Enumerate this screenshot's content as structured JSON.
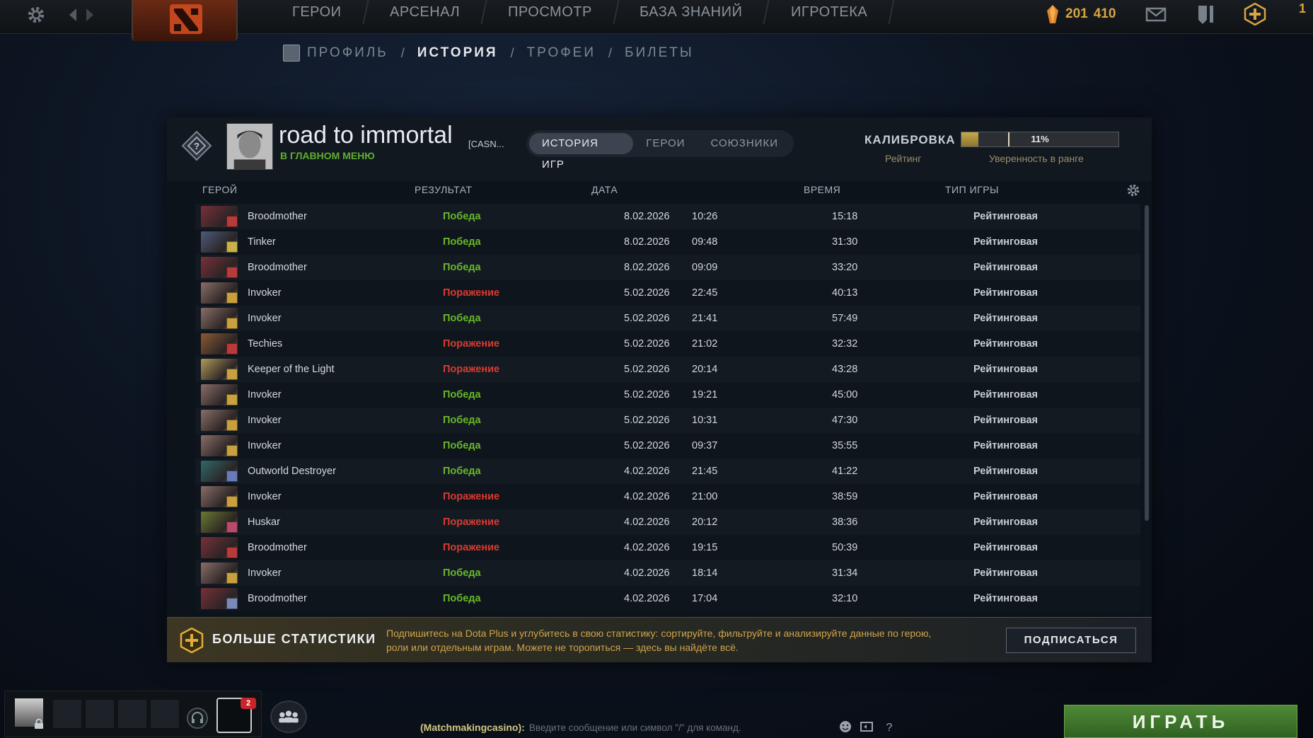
{
  "topnav": {
    "items": [
      "ГЕРОИ",
      "АРСЕНАЛ",
      "ПРОСМОТР",
      "БАЗА ЗНАНИЙ",
      "ИГРОТЕКА"
    ]
  },
  "currency": {
    "shards": "201",
    "coins": "410",
    "edge": "1"
  },
  "subnav": {
    "items": [
      "ПРОФИЛЬ",
      "ИСТОРИЯ",
      "ТРОФЕИ",
      "БИЛЕТЫ"
    ],
    "sep": "/",
    "active": "ИСТОРИЯ"
  },
  "profile": {
    "name": "road to immortal",
    "tag": "[CASN...",
    "status": "В ГЛАВНОМ МЕНЮ"
  },
  "head_tabs": {
    "items": [
      "ИСТОРИЯ ИГР",
      "ГЕРОИ",
      "СОЮЗНИКИ"
    ],
    "active": "ИСТОРИЯ ИГР"
  },
  "calibration": {
    "label": "КАЛИБРОВКА",
    "rating_label": "Рейтинг",
    "confidence_text": "11%",
    "confidence_fraction": 0.11,
    "confidence_label": "Уверенность в ранге"
  },
  "columns": {
    "hero": "ГЕРОЙ",
    "result": "РЕЗУЛЬТАТ",
    "date": "ДАТА",
    "time": "ВРЕМЯ",
    "mode": "ТИП ИГРЫ"
  },
  "matches": [
    {
      "hero": "Broodmother",
      "result": "Победа",
      "win": true,
      "date": "8.02.2026",
      "clock": "10:26",
      "duration": "15:18",
      "mode": "Рейтинговая",
      "color": "#7a2f3a",
      "role": "#b83a3a"
    },
    {
      "hero": "Tinker",
      "result": "Победа",
      "win": true,
      "date": "8.02.2026",
      "clock": "09:48",
      "duration": "31:30",
      "mode": "Рейтинговая",
      "color": "#4d5a7a",
      "role": "#c9b04a"
    },
    {
      "hero": "Broodmother",
      "result": "Победа",
      "win": true,
      "date": "8.02.2026",
      "clock": "09:09",
      "duration": "33:20",
      "mode": "Рейтинговая",
      "color": "#7a2f3a",
      "role": "#b83a3a"
    },
    {
      "hero": "Invoker",
      "result": "Поражение",
      "win": false,
      "date": "5.02.2026",
      "clock": "22:45",
      "duration": "40:13",
      "mode": "Рейтинговая",
      "color": "#8a6e68",
      "role": "#c9a040"
    },
    {
      "hero": "Invoker",
      "result": "Победа",
      "win": true,
      "date": "5.02.2026",
      "clock": "21:41",
      "duration": "57:49",
      "mode": "Рейтинговая",
      "color": "#8a6e68",
      "role": "#c9a040"
    },
    {
      "hero": "Techies",
      "result": "Поражение",
      "win": false,
      "date": "5.02.2026",
      "clock": "21:02",
      "duration": "32:32",
      "mode": "Рейтинговая",
      "color": "#8a5a34",
      "role": "#b83a3a"
    },
    {
      "hero": "Keeper of the Light",
      "result": "Поражение",
      "win": false,
      "date": "5.02.2026",
      "clock": "20:14",
      "duration": "43:28",
      "mode": "Рейтинговая",
      "color": "#b09a5a",
      "role": "#c9a040"
    },
    {
      "hero": "Invoker",
      "result": "Победа",
      "win": true,
      "date": "5.02.2026",
      "clock": "19:21",
      "duration": "45:00",
      "mode": "Рейтинговая",
      "color": "#8a6e68",
      "role": "#c9a040"
    },
    {
      "hero": "Invoker",
      "result": "Победа",
      "win": true,
      "date": "5.02.2026",
      "clock": "10:31",
      "duration": "47:30",
      "mode": "Рейтинговая",
      "color": "#8a6e68",
      "role": "#c9a040"
    },
    {
      "hero": "Invoker",
      "result": "Победа",
      "win": true,
      "date": "5.02.2026",
      "clock": "09:37",
      "duration": "35:55",
      "mode": "Рейтинговая",
      "color": "#8a6e68",
      "role": "#c9a040"
    },
    {
      "hero": "Outworld Destroyer",
      "result": "Победа",
      "win": true,
      "date": "4.02.2026",
      "clock": "21:45",
      "duration": "41:22",
      "mode": "Рейтинговая",
      "color": "#2f6a6a",
      "role": "#6a7ab8"
    },
    {
      "hero": "Invoker",
      "result": "Поражение",
      "win": false,
      "date": "4.02.2026",
      "clock": "21:00",
      "duration": "38:59",
      "mode": "Рейтинговая",
      "color": "#8a6e68",
      "role": "#c9a040"
    },
    {
      "hero": "Huskar",
      "result": "Поражение",
      "win": false,
      "date": "4.02.2026",
      "clock": "20:12",
      "duration": "38:36",
      "mode": "Рейтинговая",
      "color": "#6a7a30",
      "role": "#b84a6a"
    },
    {
      "hero": "Broodmother",
      "result": "Поражение",
      "win": false,
      "date": "4.02.2026",
      "clock": "19:15",
      "duration": "50:39",
      "mode": "Рейтинговая",
      "color": "#7a2f3a",
      "role": "#b83a3a"
    },
    {
      "hero": "Invoker",
      "result": "Победа",
      "win": true,
      "date": "4.02.2026",
      "clock": "18:14",
      "duration": "31:34",
      "mode": "Рейтинговая",
      "color": "#8a6e68",
      "role": "#c9a040"
    },
    {
      "hero": "Broodmother",
      "result": "Победа",
      "win": true,
      "date": "4.02.2026",
      "clock": "17:04",
      "duration": "32:10",
      "mode": "Рейтинговая",
      "color": "#7a2f3a",
      "role": "#7a8ab8"
    }
  ],
  "plus": {
    "title": "БОЛЬШЕ СТАТИСТИКИ",
    "text": "Подпишитесь на Dota Plus и углубитесь в свою статистику: сортируйте, фильтруйте и анализируйте данные по герою, роли или отдельным играм. Можете не торопиться — здесь вы найдёте всё.",
    "button": "ПОДПИСАТЬСЯ"
  },
  "bottom": {
    "inventory_badge": "2",
    "chat_channel": "(Matchmakingcasino):",
    "chat_placeholder": "Введите сообщение или символ \"/\" для команд.",
    "play": "ИГРАТЬ"
  },
  "colors": {
    "win": "#68b82a",
    "loss": "#d93b31",
    "gold": "#d7a642",
    "play": "#3f7a2c"
  },
  "icons": [
    "settings-gear-icon",
    "back-arrow-icon",
    "forward-arrow-icon",
    "dota-logo-icon",
    "shard-gem-icon",
    "mail-icon",
    "armory-icon",
    "dota-plus-icon",
    "rank-unknown-icon",
    "table-settings-icon",
    "lock-icon",
    "headset-icon",
    "friends-icon",
    "emoji-icon",
    "chat-swap-icon",
    "help-icon"
  ]
}
